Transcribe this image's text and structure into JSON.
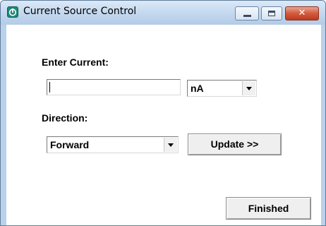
{
  "window": {
    "title": "Current Source Control",
    "controls": {
      "minimize": "minimize",
      "maximize": "maximize",
      "close": "✕"
    }
  },
  "form": {
    "current_label": "Enter Current:",
    "current_value": "",
    "unit_selected": "nA",
    "direction_label": "Direction:",
    "direction_selected": "Forward",
    "update_label": "Update >>",
    "finished_label": "Finished"
  },
  "icons": {
    "app": "app-power-icon",
    "dropdown": "chevron-down-icon"
  },
  "colors": {
    "titlebar": "#c6daf0",
    "close_button": "#d25a3d",
    "app_icon": "#1e8a78"
  }
}
